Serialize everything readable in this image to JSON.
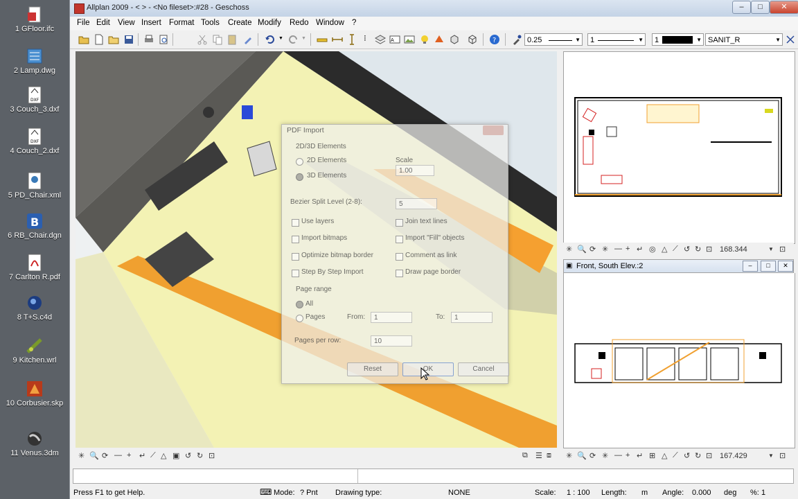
{
  "desktop": {
    "icons": [
      {
        "label": "1 GFloor.ifc",
        "icon": "ifc-file-icon"
      },
      {
        "label": "2 Lamp.dwg",
        "icon": "dwg-file-icon"
      },
      {
        "label": "3 Couch_3.dxf",
        "icon": "dxf-file-icon",
        "badge": "DXF"
      },
      {
        "label": "4 Couch_2.dxf",
        "icon": "dxf-file-icon",
        "badge": "DXF"
      },
      {
        "label": "5 PD_Chair.xml",
        "icon": "xml-file-icon"
      },
      {
        "label": "6 RB_Chair.dgn",
        "icon": "dgn-file-icon"
      },
      {
        "label": "7 Carlton R.pdf",
        "icon": "pdf-file-icon"
      },
      {
        "label": "8 T+S.c4d",
        "icon": "c4d-file-icon"
      },
      {
        "label": "9 Kitchen.wrl",
        "icon": "wrl-file-icon"
      },
      {
        "label": "10 Corbusier.skp",
        "icon": "skp-file-icon"
      },
      {
        "label": "11  Venus.3dm",
        "icon": "3dm-file-icon"
      }
    ]
  },
  "window": {
    "title": "Allplan 2009 - <      > - <No fileset>:#28 - Geschoss",
    "controls": {
      "minimize": "–",
      "maximize": "□",
      "close": "✕"
    }
  },
  "menu": [
    "File",
    "Edit",
    "View",
    "Insert",
    "Format",
    "Tools",
    "Create",
    "Modify",
    "Redo",
    "Window",
    "?"
  ],
  "toolbar": {
    "pen_thickness": "0.25",
    "line_type": "1",
    "color": "1",
    "layer": "SANIT_R"
  },
  "viewports": {
    "plan": {
      "zoom_value": "168.344"
    },
    "elevation": {
      "title": "Front, South Elev.:2",
      "zoom_value": "167.429"
    }
  },
  "dialog": {
    "title": "PDF Import",
    "group_elements": "2D/3D Elements",
    "option_2d": "2D Elements",
    "option_3d": "3D Elements",
    "scale_label": "Scale",
    "scale_value": "1.00",
    "bezier_label": "Bezier Split Level (2-8):",
    "bezier_value": "5",
    "use_layers": "Use layers",
    "join_text": "Join text lines",
    "import_bitmaps": "Import bitmaps",
    "import_fill": "Import \"Fill\" objects",
    "optimize_bitmap": "Optimize bitmap border",
    "comment_link": "Comment as link",
    "step_by_step": "Step By Step Import",
    "draw_page_border": "Draw page border",
    "page_range": "Page range",
    "all": "All",
    "pages": "Pages",
    "from_label": "From:",
    "from_value": "1",
    "to_label": "To:",
    "to_value": "1",
    "pages_per_row_label": "Pages per row:",
    "pages_per_row_value": "10",
    "reset": "Reset",
    "ok": "OK",
    "cancel": "Cancel"
  },
  "status": {
    "help": "Press F1 to get Help.",
    "mode_label": "Mode:",
    "mode_value": "? Pnt",
    "drawing_type_label": "Drawing type:",
    "drawing_type_value": "NONE",
    "scale_label": "Scale:",
    "scale_value": "1 : 100",
    "length_label": "Length:",
    "length_unit": "m",
    "angle_label": "Angle:",
    "angle_value": "0.000",
    "angle_unit": "deg",
    "percent_label": "%:",
    "percent_value": "1"
  },
  "colors": {
    "accent_orange": "#f5a030",
    "titlebar": "#c4d3e6",
    "plan_red": "#d42020"
  }
}
